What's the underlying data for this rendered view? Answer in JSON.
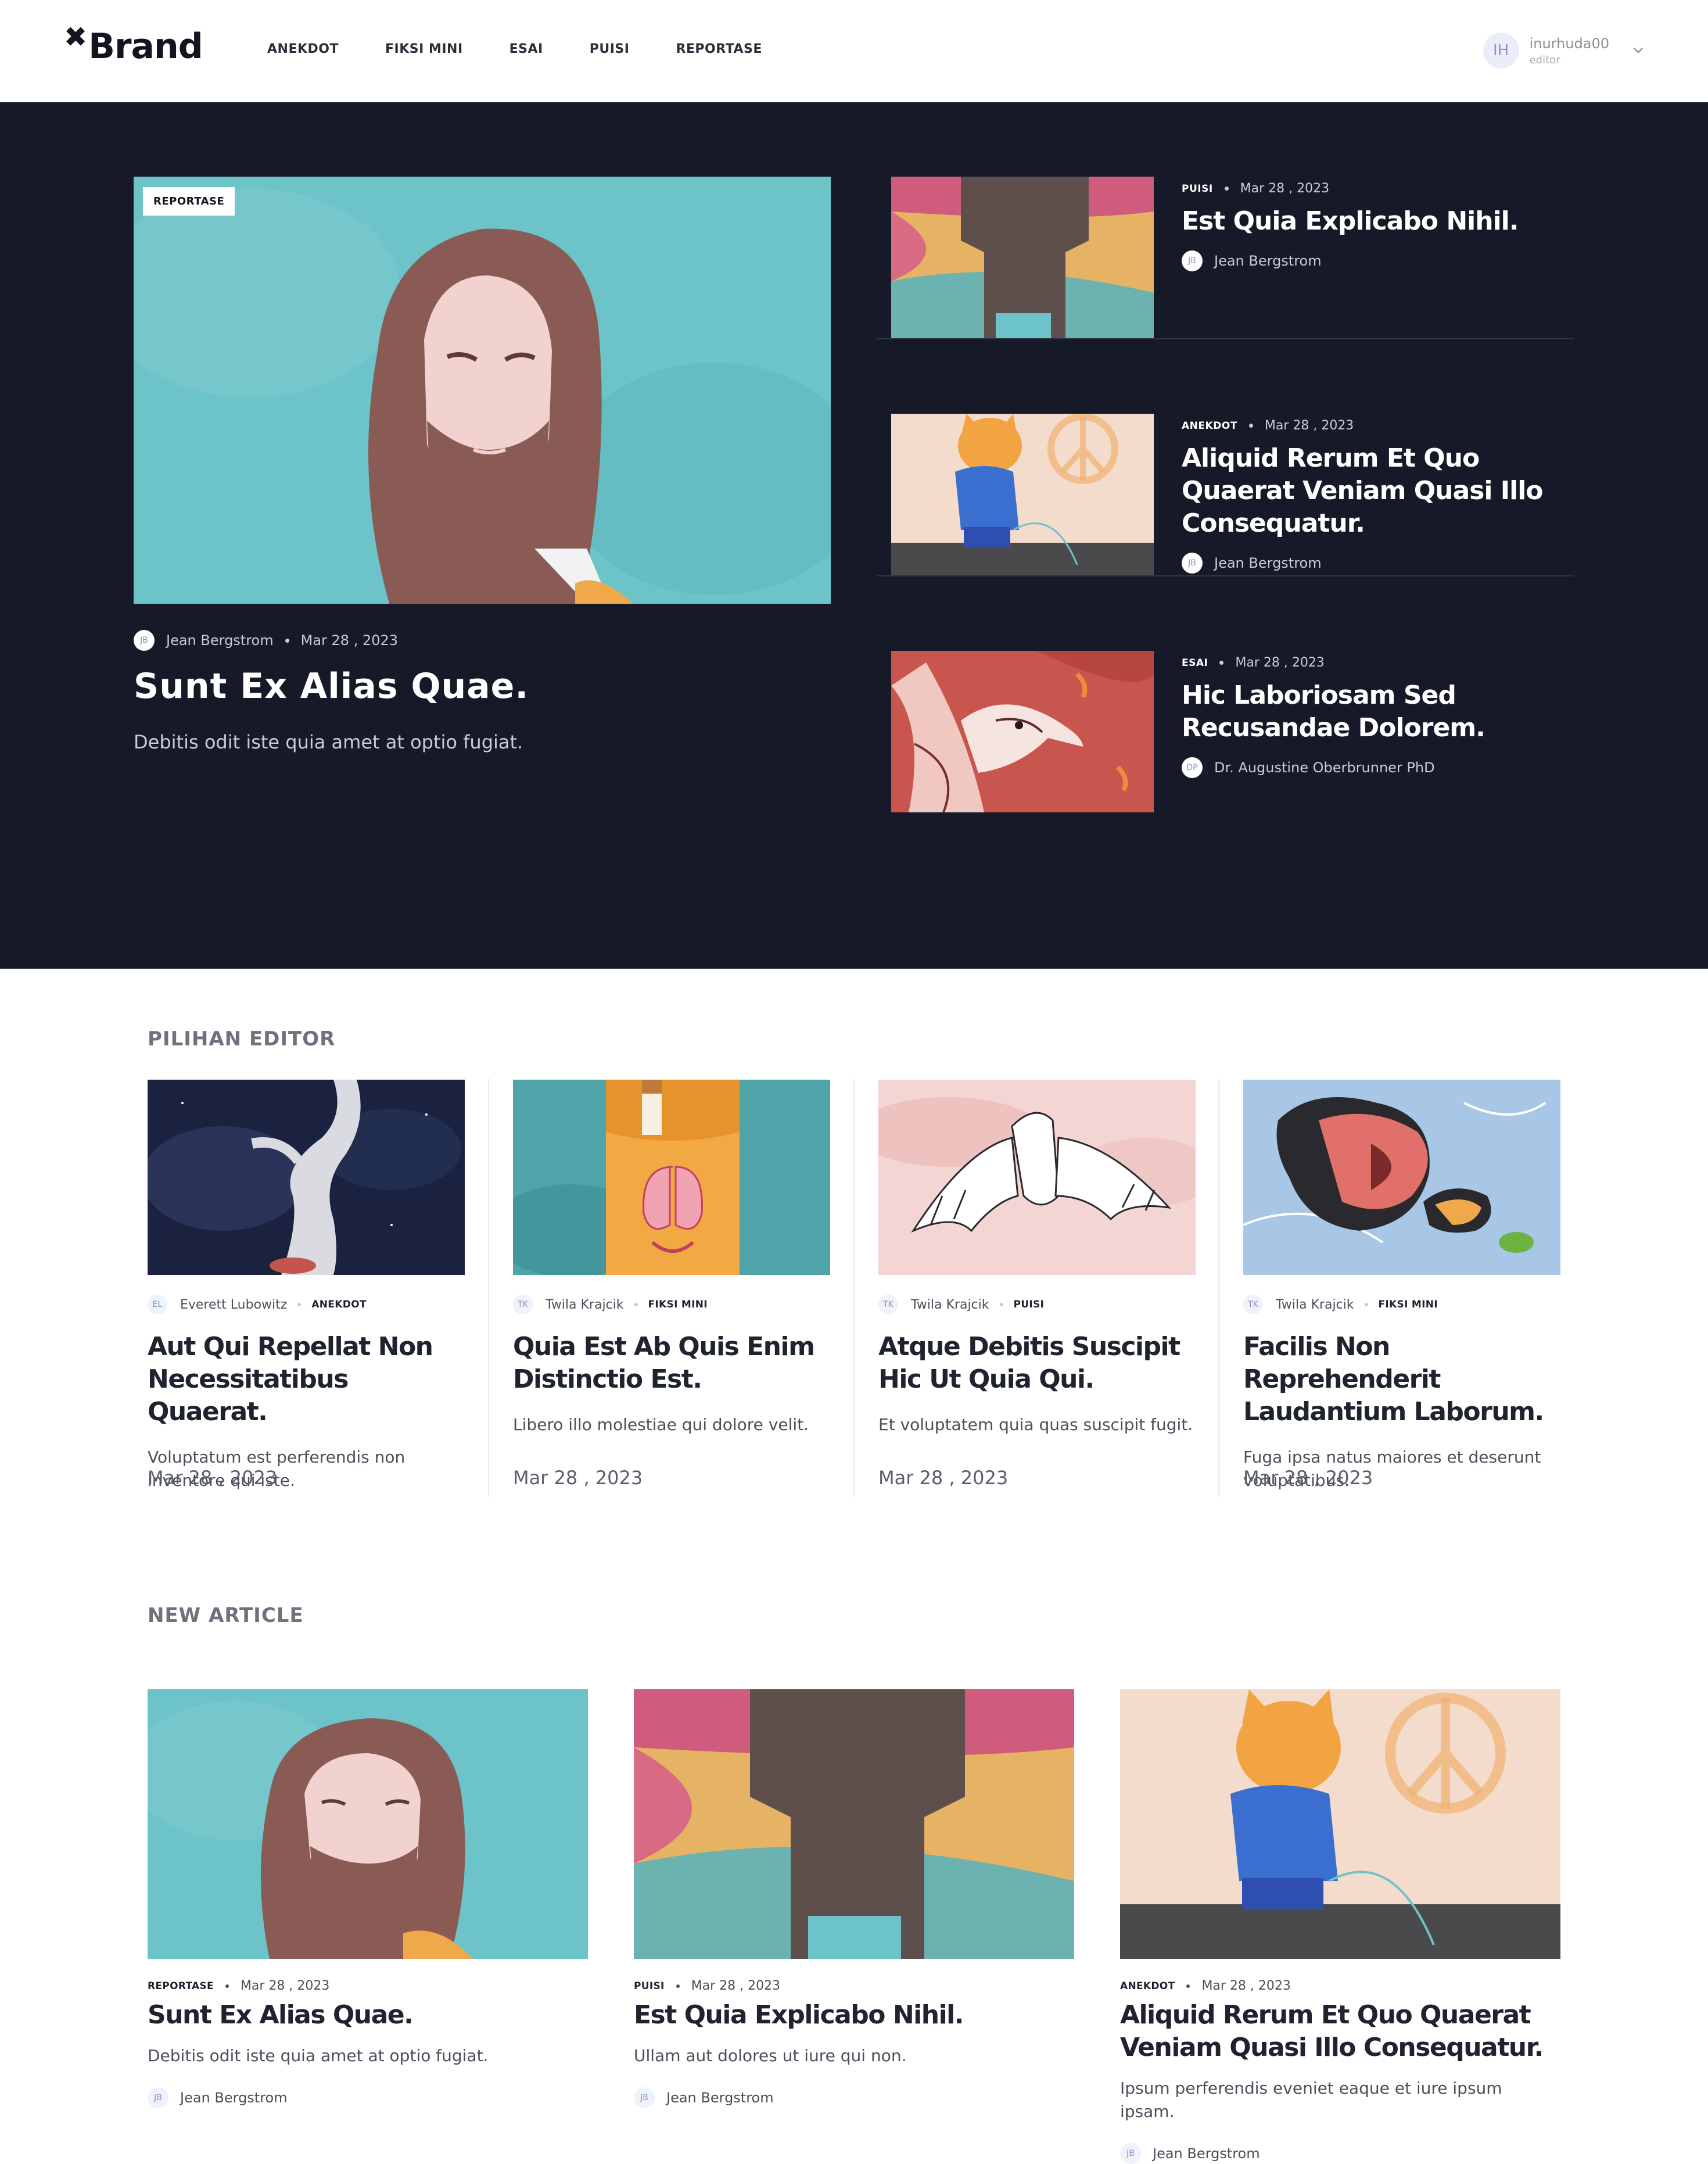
{
  "nav": {
    "logo_mark": "✖",
    "logo_text": "Brand",
    "menu": [
      "ANEKDOT",
      "FIKSI MINI",
      "ESAI",
      "PUISI",
      "REPORTASE"
    ],
    "user": {
      "initials": "IH",
      "name": "inurhuda00",
      "role": "editor",
      "chevron": "chevron-down-icon"
    }
  },
  "hero": {
    "main": {
      "badge": "REPORTASE",
      "author_initials": "JB",
      "author": "Jean Bergstrom",
      "date": "Mar 28 , 2023",
      "title": "Sunt Ex Alias Quae.",
      "desc": "Debitis odit iste quia amet at optio fugiat."
    },
    "side": [
      {
        "category": "PUISI",
        "date": "Mar 28 , 2023",
        "title": "Est Quia Explicabo Nihil.",
        "author_initials": "JB",
        "author": "Jean Bergstrom"
      },
      {
        "category": "ANEKDOT",
        "date": "Mar 28 , 2023",
        "title": "Aliquid Rerum Et Quo Quaerat Veniam Quasi Illo Consequatur.",
        "author_initials": "JB",
        "author": "Jean Bergstrom"
      },
      {
        "category": "ESAI",
        "date": "Mar 28 , 2023",
        "title": "Hic Laboriosam Sed Recusandae Dolorem.",
        "author_initials": "DP",
        "author": "Dr. Augustine Oberbrunner PhD"
      }
    ]
  },
  "editor_picks": {
    "heading": "PILIHAN EDITOR",
    "items": [
      {
        "author_initials": "EL",
        "author": "Everett Lubowitz",
        "category": "ANEKDOT",
        "title": "Aut Qui Repellat Non Necessitatibus Quaerat.",
        "desc": "Voluptatum est perferendis non inventore qui iste.",
        "date": "Mar 28 , 2023"
      },
      {
        "author_initials": "TK",
        "author": "Twila Krajcik",
        "category": "FIKSI MINI",
        "title": "Quia Est Ab Quis Enim Distinctio Est.",
        "desc": "Libero illo molestiae qui dolore velit.",
        "date": "Mar 28 , 2023",
        "image_caption": "Lungs Smile"
      },
      {
        "author_initials": "TK",
        "author": "Twila Krajcik",
        "category": "PUISI",
        "title": "Atque Debitis Suscipit Hic Ut Quia Qui.",
        "desc": "Et voluptatem quia quas suscipit fugit.",
        "date": "Mar 28 , 2023"
      },
      {
        "author_initials": "TK",
        "author": "Twila Krajcik",
        "category": "FIKSI MINI",
        "title": "Facilis Non Reprehenderit Laudantium Laborum.",
        "desc": "Fuga ipsa natus maiores et deserunt voluptatibus.",
        "date": "Mar 28 , 2023"
      }
    ]
  },
  "new_article": {
    "heading": "NEW ARTICLE",
    "items": [
      {
        "category": "REPORTASE",
        "date": "Mar 28 , 2023",
        "title": "Sunt Ex Alias Quae.",
        "desc": "Debitis odit iste quia amet at optio fugiat.",
        "author_initials": "JB",
        "author": "Jean Bergstrom"
      },
      {
        "category": "PUISI",
        "date": "Mar 28 , 2023",
        "title": "Est Quia Explicabo Nihil.",
        "desc": "Ullam aut dolores ut iure qui non.",
        "author_initials": "JB",
        "author": "Jean Bergstrom"
      },
      {
        "category": "ANEKDOT",
        "date": "Mar 28 , 2023",
        "title": "Aliquid Rerum Et Quo Quaerat Veniam Quasi Illo Consequatur.",
        "desc": "Ipsum perferendis eveniet eaque et iure ipsum ipsam.",
        "author_initials": "JB",
        "author": "Jean Bergstrom"
      }
    ]
  },
  "colors": {
    "hero_bg": "#161a28",
    "accent_teal": "#6cc3c8",
    "text_dark": "#1f2330",
    "muted": "#6d727d"
  }
}
